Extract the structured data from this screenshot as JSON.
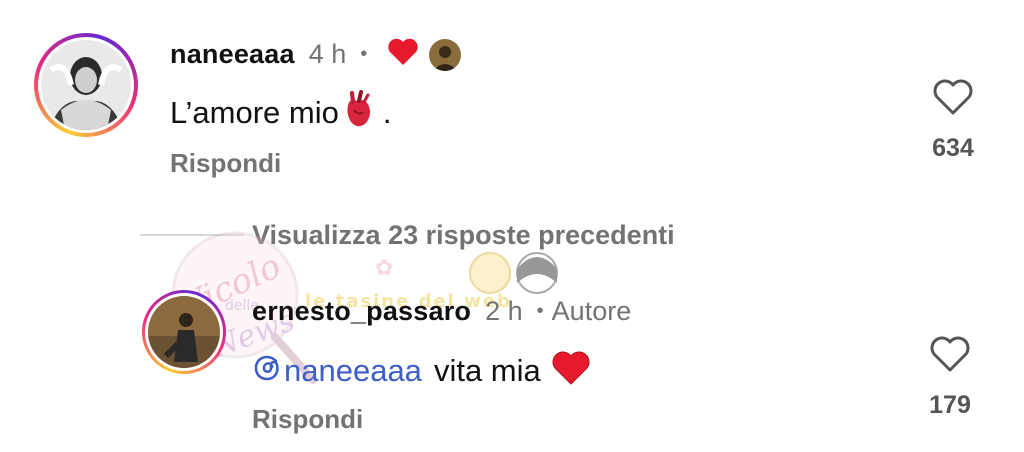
{
  "comment1": {
    "username": "naneeaaa",
    "time": "4 h",
    "dot": "•",
    "text": "L’amore mio",
    "text_after": ".",
    "reply_label": "Rispondi",
    "like_count": "634"
  },
  "view_replies": "Visualizza 23 risposte precedenti",
  "comment2": {
    "username": "ernesto_passaro",
    "time": "2 h",
    "dot": "•",
    "author_label": "Autore",
    "mention": "naneeaaa",
    "text": "vita mia",
    "reply_label": "Rispondi",
    "like_count": "179"
  },
  "watermark": {
    "text1": "Vicolo",
    "text2": "delle",
    "text3": "News",
    "text4": "le tasine del web"
  },
  "colors": {
    "heart_red": "#e8192c",
    "mention_blue": "#3d5ec9",
    "meta_gray": "#737373"
  },
  "icons": [
    "heart-outline-icon",
    "red-heart-icon",
    "anatomical-heart-icon",
    "threads-icon"
  ]
}
